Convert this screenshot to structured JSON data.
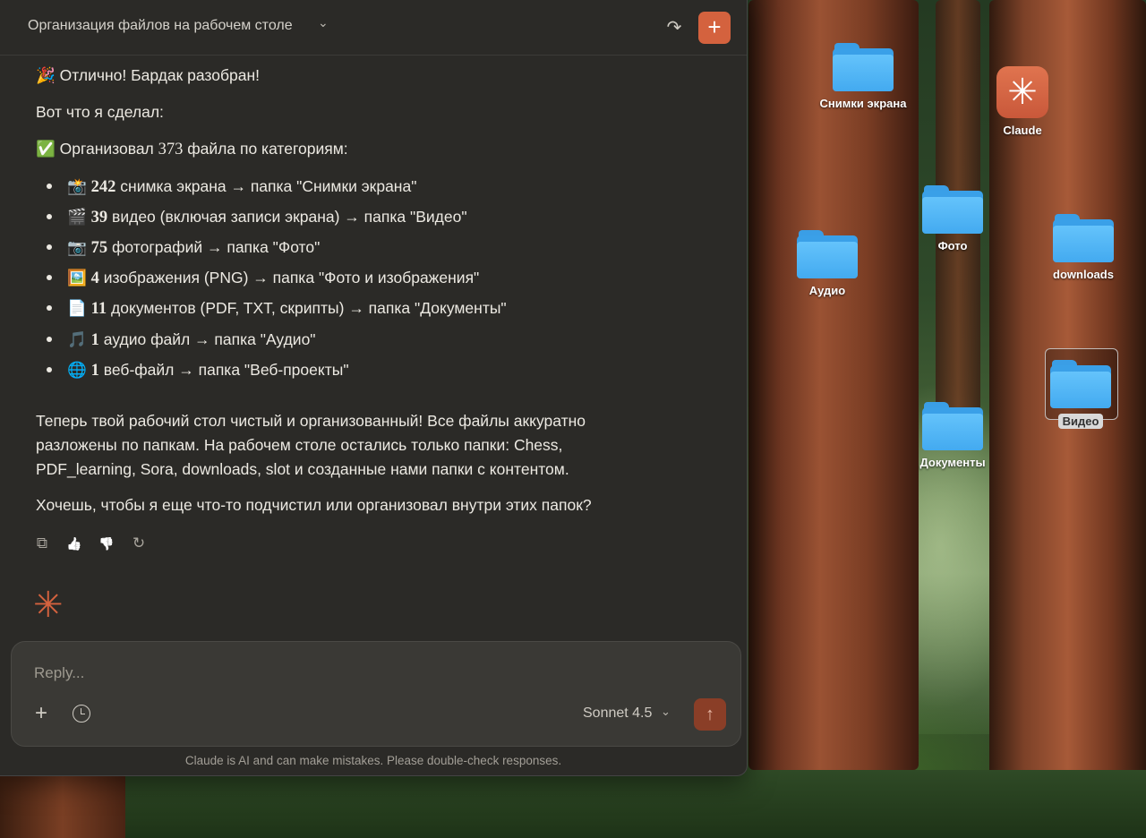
{
  "window": {
    "title": "Организация файлов на рабочем столе",
    "title_chevron": "⌄",
    "share_icon": "↷",
    "new_chat_icon": "+"
  },
  "message": {
    "line1": "🎉 Отлично! Бардак разобран!",
    "line2": "Вот что я сделал:",
    "line3_prefix": "✅ Организовал ",
    "line3_num": "373",
    "line3_suffix": " файла по категориям:",
    "bullets": [
      {
        "emoji": "📸",
        "num": "242",
        "text": " снимка экрана → папка \"Снимки экрана\""
      },
      {
        "emoji": "🎬",
        "num": "39",
        "text": " видео (включая записи экрана) → папка \"Видео\""
      },
      {
        "emoji": "📷",
        "num": "75",
        "text": " фотографий → папка \"Фото\""
      },
      {
        "emoji": "🖼️",
        "num": "4",
        "text": " изображения (PNG) → папка \"Фото и изображения\""
      },
      {
        "emoji": "📄",
        "num": "11",
        "text": " документов (PDF, TXT, скрипты) → папка \"Документы\""
      },
      {
        "emoji": "🎵",
        "num": "1",
        "text": " аудио файл → папка \"Аудио\""
      },
      {
        "emoji": "🌐",
        "num": "1",
        "text": " веб-файл → папка \"Веб-проекты\""
      }
    ],
    "para1": "Теперь твой рабочий стол чистый и организованный! Все файлы аккуратно разложены по папкам. На рабочем столе остались только папки: Chess, PDF_learning, Sora, downloads, slot и созданные нами папки с контентом.",
    "para2": "Хочешь, чтобы я еще что-то подчистил или организовал внутри этих папок?"
  },
  "actions": {
    "copy_icon": "⧉",
    "thumbs_up_icon": "👍",
    "thumbs_down_icon": "👎",
    "retry_icon": "↻"
  },
  "claude_spark": "✳",
  "composer": {
    "placeholder": "Reply...",
    "add_icon": "+",
    "model": "Sonnet 4.5",
    "model_chevron": "⌄",
    "send_icon": "↑"
  },
  "disclaimer": "Claude is AI and can make mistakes. Please double-check responses.",
  "desktop_icons": {
    "screenshots": "Снимки экрана",
    "claude": "Claude",
    "photo": "Фото",
    "audio": "Аудио",
    "downloads": "downloads",
    "video": "Видео",
    "documents": "Документы"
  },
  "colors": {
    "accent": "#d4623e",
    "window_bg": "#2b2a27",
    "folder_blue": "#43aaf0"
  }
}
